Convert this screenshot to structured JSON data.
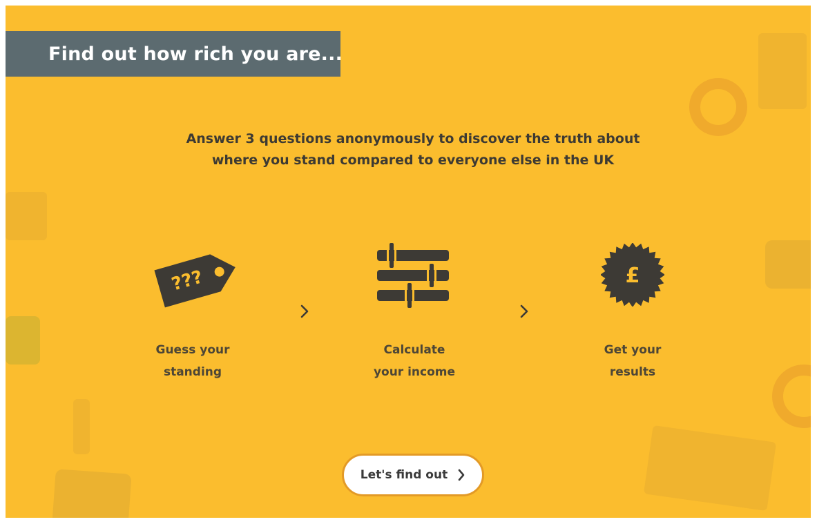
{
  "header": {
    "title": "Find out how rich you are..."
  },
  "intro": {
    "line1": "Answer 3 questions anonymously to discover the truth about",
    "line2": "where you stand compared to everyone else in the UK"
  },
  "steps": [
    {
      "icon": "price-tag-icon",
      "tag_text": "???",
      "label_line1": "Guess your",
      "label_line2": "standing"
    },
    {
      "icon": "sliders-icon",
      "label_line1": "Calculate",
      "label_line2": "your income"
    },
    {
      "icon": "pound-badge-icon",
      "badge_text": "£",
      "label_line1": "Get your",
      "label_line2": "results"
    }
  ],
  "cta": {
    "label": "Let's find out"
  },
  "colors": {
    "background": "#fbbd2e",
    "title_bar": "#5c6b70",
    "icon_dark": "#3d3a35",
    "cta_border": "#e39a26"
  }
}
